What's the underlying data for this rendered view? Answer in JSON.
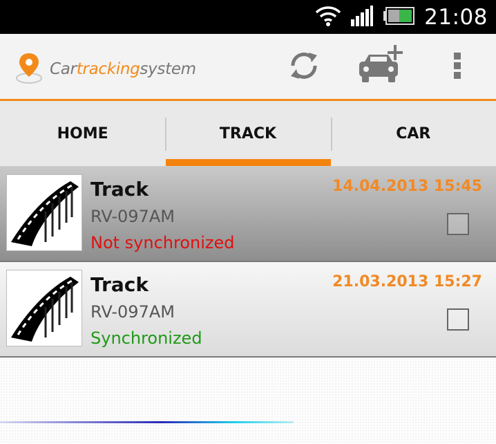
{
  "status_bar": {
    "time": "21:08",
    "icons": [
      "wifi-icon",
      "signal-icon",
      "battery-icon"
    ]
  },
  "action_bar": {
    "logo_parts": [
      "Car",
      "tracking",
      "system"
    ],
    "actions": [
      "refresh-icon",
      "add-car-icon",
      "overflow-menu-icon"
    ],
    "accent_color": "#f28a1a"
  },
  "tabs": [
    {
      "label": "HOME",
      "active": false
    },
    {
      "label": "TRACK",
      "active": true
    },
    {
      "label": "CAR",
      "active": false
    }
  ],
  "tracks": [
    {
      "title": "Track",
      "plate": "RV-097AM",
      "status": "Not synchronized",
      "datetime": "14.04.2013 15:45",
      "checked": false,
      "selected": true
    },
    {
      "title": "Track",
      "plate": "RV-097AM",
      "status": "Synchronized",
      "datetime": "21.03.2013 15:27",
      "checked": false,
      "selected": false
    }
  ]
}
